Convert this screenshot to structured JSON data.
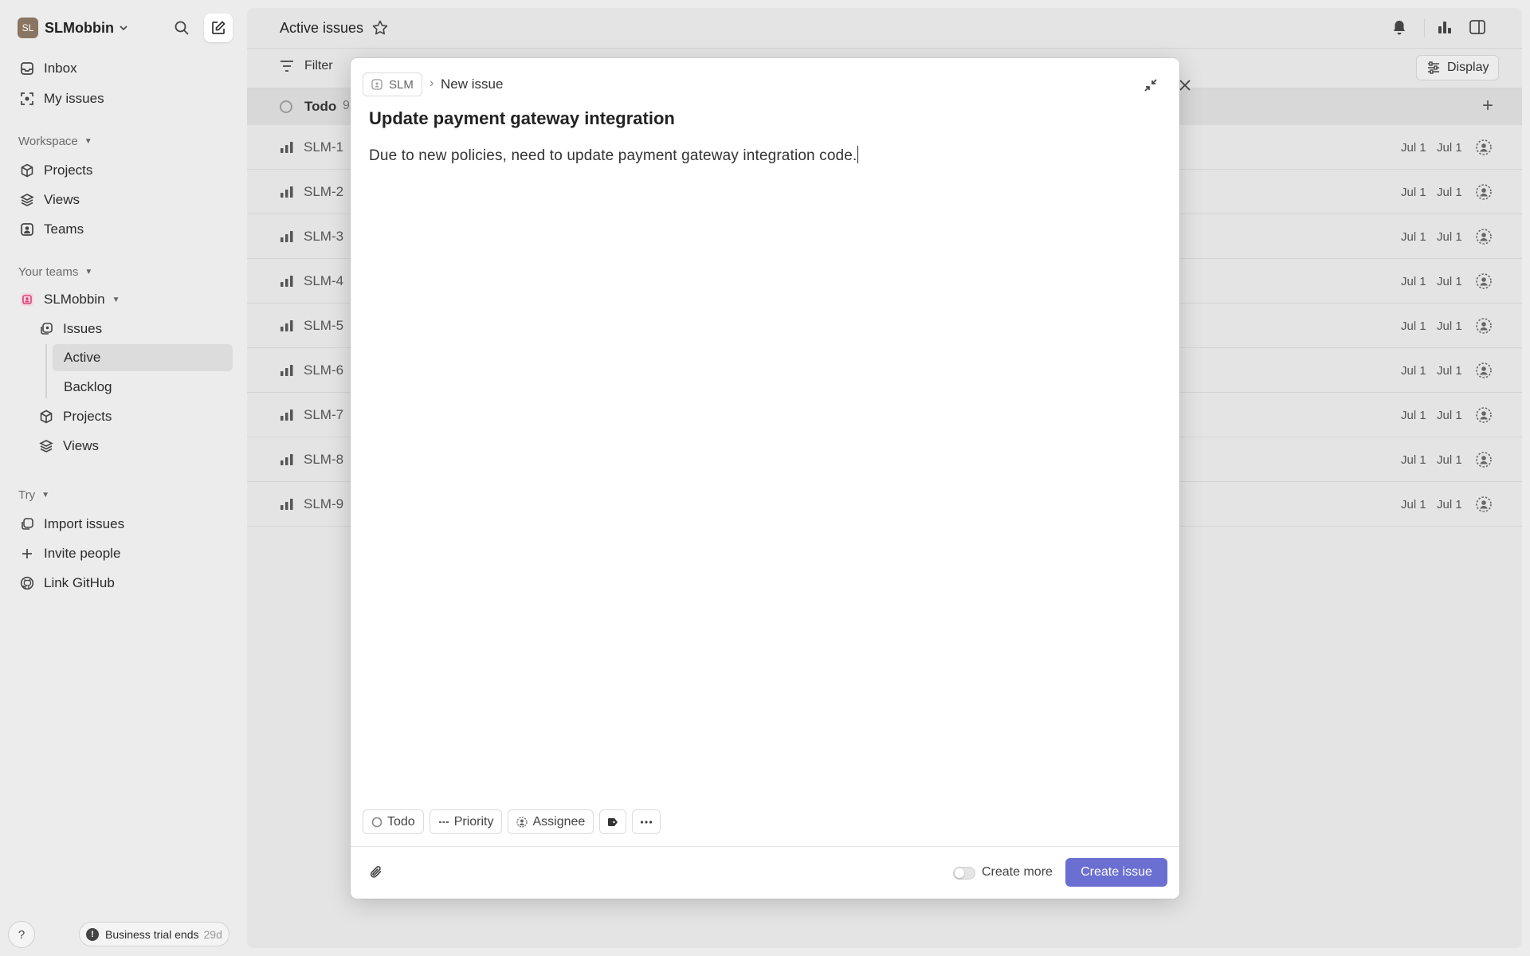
{
  "workspace": {
    "initials": "SL",
    "name": "SLMobbin"
  },
  "sidebar": {
    "top_items": [
      {
        "label": "Inbox",
        "icon": "inbox-icon"
      },
      {
        "label": "My issues",
        "icon": "my-issues-icon"
      }
    ],
    "workspace_section": {
      "label": "Workspace",
      "items": [
        {
          "label": "Projects",
          "icon": "cube-icon"
        },
        {
          "label": "Views",
          "icon": "layers-icon"
        },
        {
          "label": "Teams",
          "icon": "teams-icon"
        }
      ]
    },
    "teams_section": {
      "label": "Your teams",
      "team": {
        "name": "SLMobbin"
      },
      "items": [
        {
          "label": "Issues"
        },
        {
          "label": "Active"
        },
        {
          "label": "Backlog"
        },
        {
          "label": "Projects"
        },
        {
          "label": "Views"
        }
      ]
    },
    "try_section": {
      "label": "Try",
      "items": [
        {
          "label": "Import issues",
          "icon": "import-icon"
        },
        {
          "label": "Invite people",
          "icon": "plus-icon"
        },
        {
          "label": "Link GitHub",
          "icon": "github-icon"
        }
      ]
    },
    "help_label": "?",
    "trial": {
      "bang": "!",
      "label": "Business trial ends",
      "days": "29d"
    }
  },
  "main": {
    "title": "Active issues",
    "filter_label": "Filter",
    "display_label": "Display",
    "group": {
      "name": "Todo",
      "count": "9"
    },
    "issues": [
      {
        "id": "SLM-1",
        "date1": "Jul 1",
        "date2": "Jul 1"
      },
      {
        "id": "SLM-2",
        "date1": "Jul 1",
        "date2": "Jul 1"
      },
      {
        "id": "SLM-3",
        "date1": "Jul 1",
        "date2": "Jul 1"
      },
      {
        "id": "SLM-4",
        "date1": "Jul 1",
        "date2": "Jul 1"
      },
      {
        "id": "SLM-5",
        "date1": "Jul 1",
        "date2": "Jul 1"
      },
      {
        "id": "SLM-6",
        "date1": "Jul 1",
        "date2": "Jul 1"
      },
      {
        "id": "SLM-7",
        "date1": "Jul 1",
        "date2": "Jul 1"
      },
      {
        "id": "SLM-8",
        "date1": "Jul 1",
        "date2": "Jul 1"
      },
      {
        "id": "SLM-9",
        "date1": "Jul 1",
        "date2": "Jul 1"
      }
    ]
  },
  "modal": {
    "team_chip": "SLM",
    "crumb_sep": "›",
    "crumb_current": "New issue",
    "title": "Update payment gateway integration",
    "description": "Due to new policies, need to update payment gateway integration code.",
    "props": {
      "status": "Todo",
      "priority": "Priority",
      "assignee": "Assignee"
    },
    "create_more_label": "Create more",
    "create_more_on": false,
    "create_button": "Create issue"
  },
  "colors": {
    "accent": "#6a6fd1",
    "sidebar_bg": "#ececec",
    "main_bg": "#e4e4e4"
  }
}
